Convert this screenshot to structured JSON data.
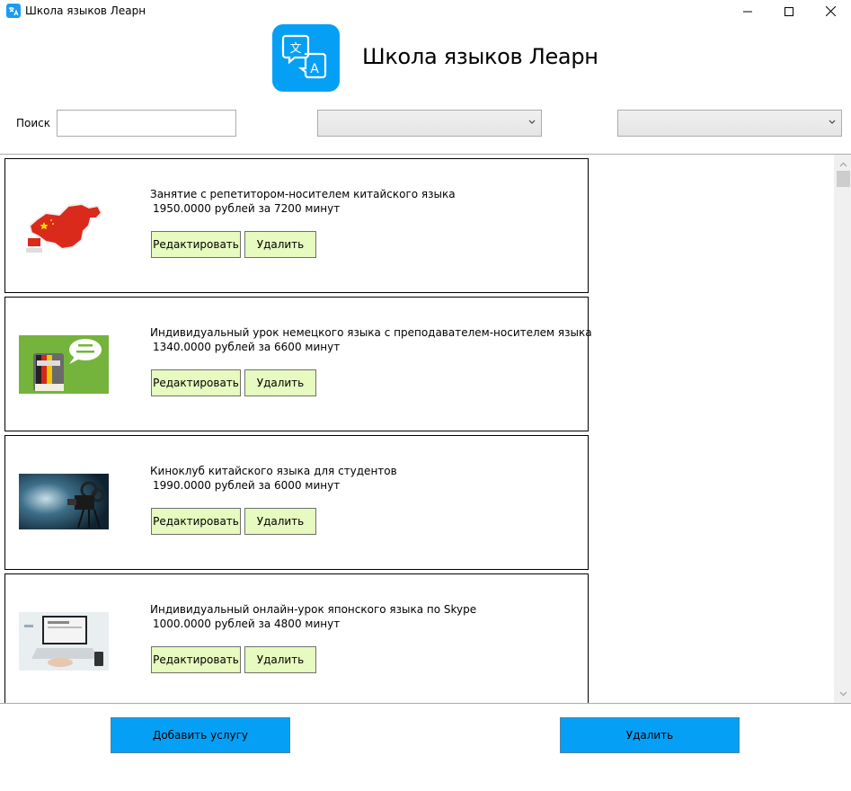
{
  "window": {
    "title": "Школа языков Леарн"
  },
  "header": {
    "title": "Школа языков Леарн",
    "logo_icon": "translate-icon"
  },
  "filters": {
    "search_label": "Поиск",
    "search_value": "",
    "sort_value": "",
    "filter_value": ""
  },
  "services": [
    {
      "title": "Занятие с репетитором-носителем китайского языка",
      "price": "1950.0000 рублей за 7200 минут",
      "edit_label": "Редактировать",
      "delete_label": "Удалить",
      "image": "china-map"
    },
    {
      "title": "Индивидуальный урок немецкого языка с преподавателем-носителем языка",
      "price": "1340.0000 рублей за 6600 минут",
      "edit_label": "Редактировать",
      "delete_label": "Удалить",
      "image": "german-book"
    },
    {
      "title": "Киноклуб китайского языка для студентов",
      "price": "1990.0000 рублей за 6000 минут",
      "edit_label": "Редактировать",
      "delete_label": "Удалить",
      "image": "film-projector"
    },
    {
      "title": "Индивидуальный онлайн-урок японского языка по Skype",
      "price": "1000.0000 рублей за 4800 минут",
      "edit_label": "Редактировать",
      "delete_label": "Удалить",
      "image": "laptop"
    }
  ],
  "footer": {
    "add_label": "Добавить услугу",
    "delete_label": "Удалить"
  },
  "colors": {
    "accent": "#05a0f5",
    "card_button": "#e7fabf"
  }
}
